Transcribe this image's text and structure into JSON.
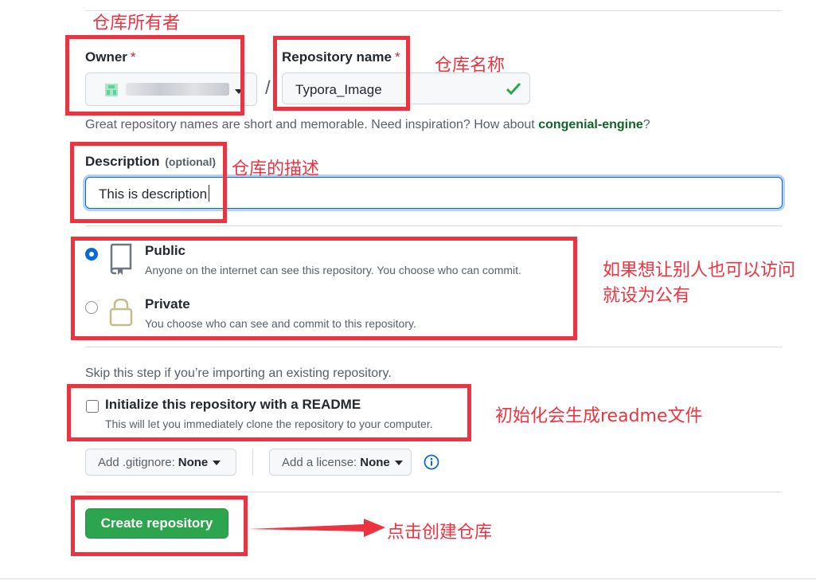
{
  "form": {
    "owner_label": "Owner",
    "required_mark": "*",
    "repo_name_label": "Repository name",
    "slash": "/",
    "repo_name_value": "Typora_Image",
    "hint_prefix": "Great repository names are short and memorable. Need inspiration? How about ",
    "hint_suggestion": "congenial-engine",
    "hint_suffix": "?",
    "description_label": "Description",
    "description_optional": "(optional)",
    "description_value": "This is description"
  },
  "visibility": {
    "public_title": "Public",
    "public_desc": "Anyone on the internet can see this repository. You choose who can commit.",
    "private_title": "Private",
    "private_desc": "You choose who can see and commit to this repository.",
    "selected": "Public"
  },
  "init": {
    "skip_text": "Skip this step if you’re importing an existing repository.",
    "readme_label": "Initialize this repository with a README",
    "readme_desc": "This will let you immediately clone the repository to your computer.",
    "readme_checked": false,
    "gitignore_label": "Add .gitignore:",
    "gitignore_value": "None",
    "license_label": "Add a license:",
    "license_value": "None"
  },
  "submit": {
    "create_label": "Create repository"
  },
  "annotations": {
    "owner": "仓库所有者",
    "repo_name": "仓库名称",
    "description": "仓库的描述",
    "visibility_line1": "如果想让别人也可以访问",
    "visibility_line2": "就设为公有",
    "readme": "初始化会生成readme文件",
    "create": "点击创建仓库"
  },
  "colors": {
    "annotation_red": "#ee3340",
    "primary_green": "#2da44e",
    "suggestion_green": "#116329",
    "check_green": "#2da44e",
    "focus_blue": "#0969da"
  }
}
